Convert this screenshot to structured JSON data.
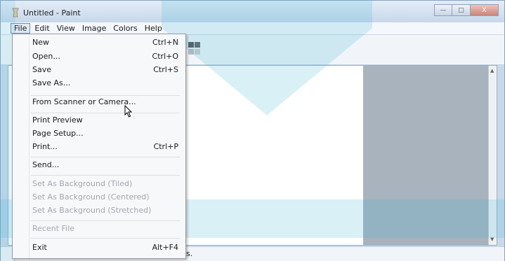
{
  "window": {
    "title": "Untitled - Paint",
    "controls": {
      "minimize": "—",
      "maximize": "□",
      "close": "X"
    }
  },
  "menubar": {
    "items": [
      {
        "label": "File",
        "active": true
      },
      {
        "label": "Edit"
      },
      {
        "label": "View"
      },
      {
        "label": "Image"
      },
      {
        "label": "Colors"
      },
      {
        "label": "Help"
      }
    ]
  },
  "file_menu": {
    "items": [
      {
        "label": "New",
        "shortcut": "Ctrl+N",
        "enabled": true
      },
      {
        "label": "Open...",
        "shortcut": "Ctrl+O",
        "enabled": true
      },
      {
        "label": "Save",
        "shortcut": "Ctrl+S",
        "enabled": true
      },
      {
        "label": "Save As...",
        "shortcut": "",
        "enabled": true
      },
      {
        "label": "From Scanner or Camera...",
        "shortcut": "",
        "enabled": true
      },
      {
        "label": "Print Preview",
        "shortcut": "",
        "enabled": true
      },
      {
        "label": "Page Setup...",
        "shortcut": "",
        "enabled": true
      },
      {
        "label": "Print...",
        "shortcut": "Ctrl+P",
        "enabled": true
      },
      {
        "label": "Send...",
        "shortcut": "",
        "enabled": true
      },
      {
        "label": "Set As Background (Tiled)",
        "shortcut": "",
        "enabled": false
      },
      {
        "label": "Set As Background (Centered)",
        "shortcut": "",
        "enabled": false
      },
      {
        "label": "Set As Background (Stretched)",
        "shortcut": "",
        "enabled": false
      },
      {
        "label": "Recent File",
        "shortcut": "",
        "enabled": false
      },
      {
        "label": "Exit",
        "shortcut": "Alt+F4",
        "enabled": true
      }
    ]
  },
  "statusbar": {
    "text": "s."
  },
  "colors": {
    "accent": "#c9d9ea",
    "disabled_text": "#a2a8ae",
    "watermark": "#3fb4d6"
  },
  "icons": [
    "paint-app-icon",
    "minimize-icon",
    "maximize-icon",
    "close-icon",
    "mouse-cursor-icon",
    "scroll-up-arrow-icon",
    "scroll-down-arrow-icon"
  ]
}
